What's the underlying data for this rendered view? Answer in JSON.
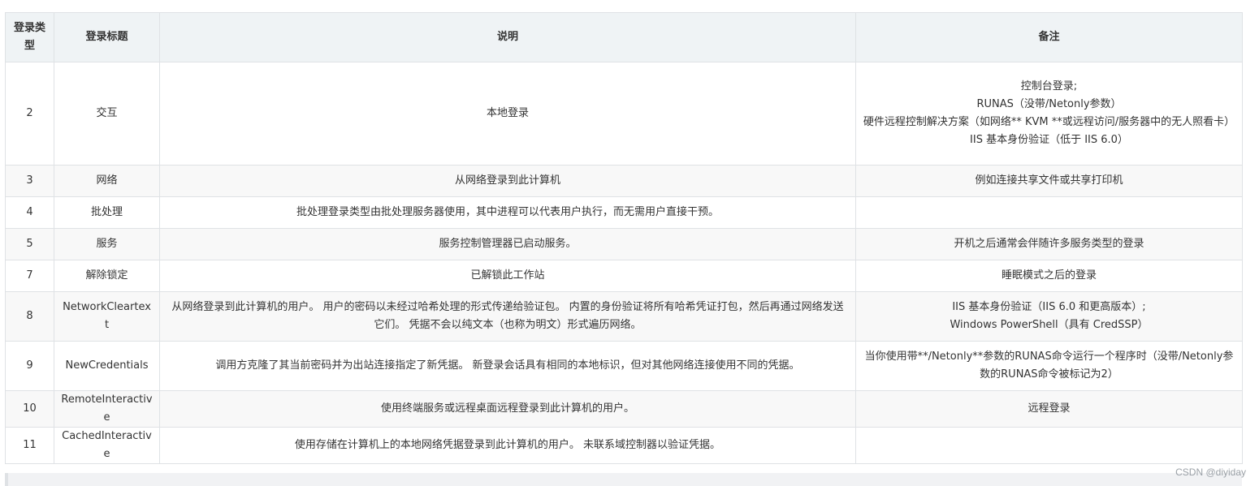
{
  "table": {
    "headers": [
      "登录类型",
      "登录标题",
      "说明",
      "备注"
    ],
    "rows": [
      {
        "type": "2",
        "title": "交互",
        "desc": [
          "本地登录"
        ],
        "note": [
          "控制台登录;",
          "RUNAS（没带/Netonly参数）",
          "硬件远程控制解决方案（如网络** KVM **或远程访问/服务器中的无人照看卡）",
          "IIS 基本身份验证（低于 IIS 6.0）"
        ]
      },
      {
        "type": "3",
        "title": "网络",
        "desc": [
          "从网络登录到此计算机"
        ],
        "note": [
          "例如连接共享文件或共享打印机"
        ]
      },
      {
        "type": "4",
        "title": "批处理",
        "desc": [
          "批处理登录类型由批处理服务器使用，其中进程可以代表用户执行，而无需用户直接干预。"
        ],
        "note": []
      },
      {
        "type": "5",
        "title": "服务",
        "desc": [
          "服务控制管理器已启动服务。"
        ],
        "note": [
          "开机之后通常会伴随许多服务类型的登录"
        ]
      },
      {
        "type": "7",
        "title": "解除锁定",
        "desc": [
          "已解锁此工作站"
        ],
        "note": [
          "睡眠模式之后的登录"
        ]
      },
      {
        "type": "8",
        "title": "NetworkCleartext",
        "desc": [
          "从网络登录到此计算机的用户。 用户的密码以未经过哈希处理的形式传递给验证包。 内置的身份验证将所有哈希凭证打包，然后再通过网络发送它们。 凭据不会以纯文本（也称为明文）形式遍历网络。"
        ],
        "note": [
          "IIS 基本身份验证（IIS 6.0 和更高版本）;",
          "Windows PowerShell（具有 CredSSP）"
        ]
      },
      {
        "type": "9",
        "title": "NewCredentials",
        "desc": [
          "调用方克隆了其当前密码并为出站连接指定了新凭据。 新登录会话具有相同的本地标识，但对其他网络连接使用不同的凭据。"
        ],
        "note": [
          "当你使用带**/Netonly**参数的RUNAS命令运行一个程序时（没带/Netonly参数的RUNAS命令被标记为2）"
        ]
      },
      {
        "type": "10",
        "title": "RemoteInteractive",
        "desc": [
          "使用终端服务或远程桌面远程登录到此计算机的用户。"
        ],
        "note": [
          "远程登录"
        ]
      },
      {
        "type": "11",
        "title": "CachedInteractive",
        "desc": [
          "使用存储在计算机上的本地网络凭据登录到此计算机的用户。 未联系域控制器以验证凭据。"
        ],
        "note": []
      }
    ]
  },
  "watermark": "CSDN @diyiday"
}
